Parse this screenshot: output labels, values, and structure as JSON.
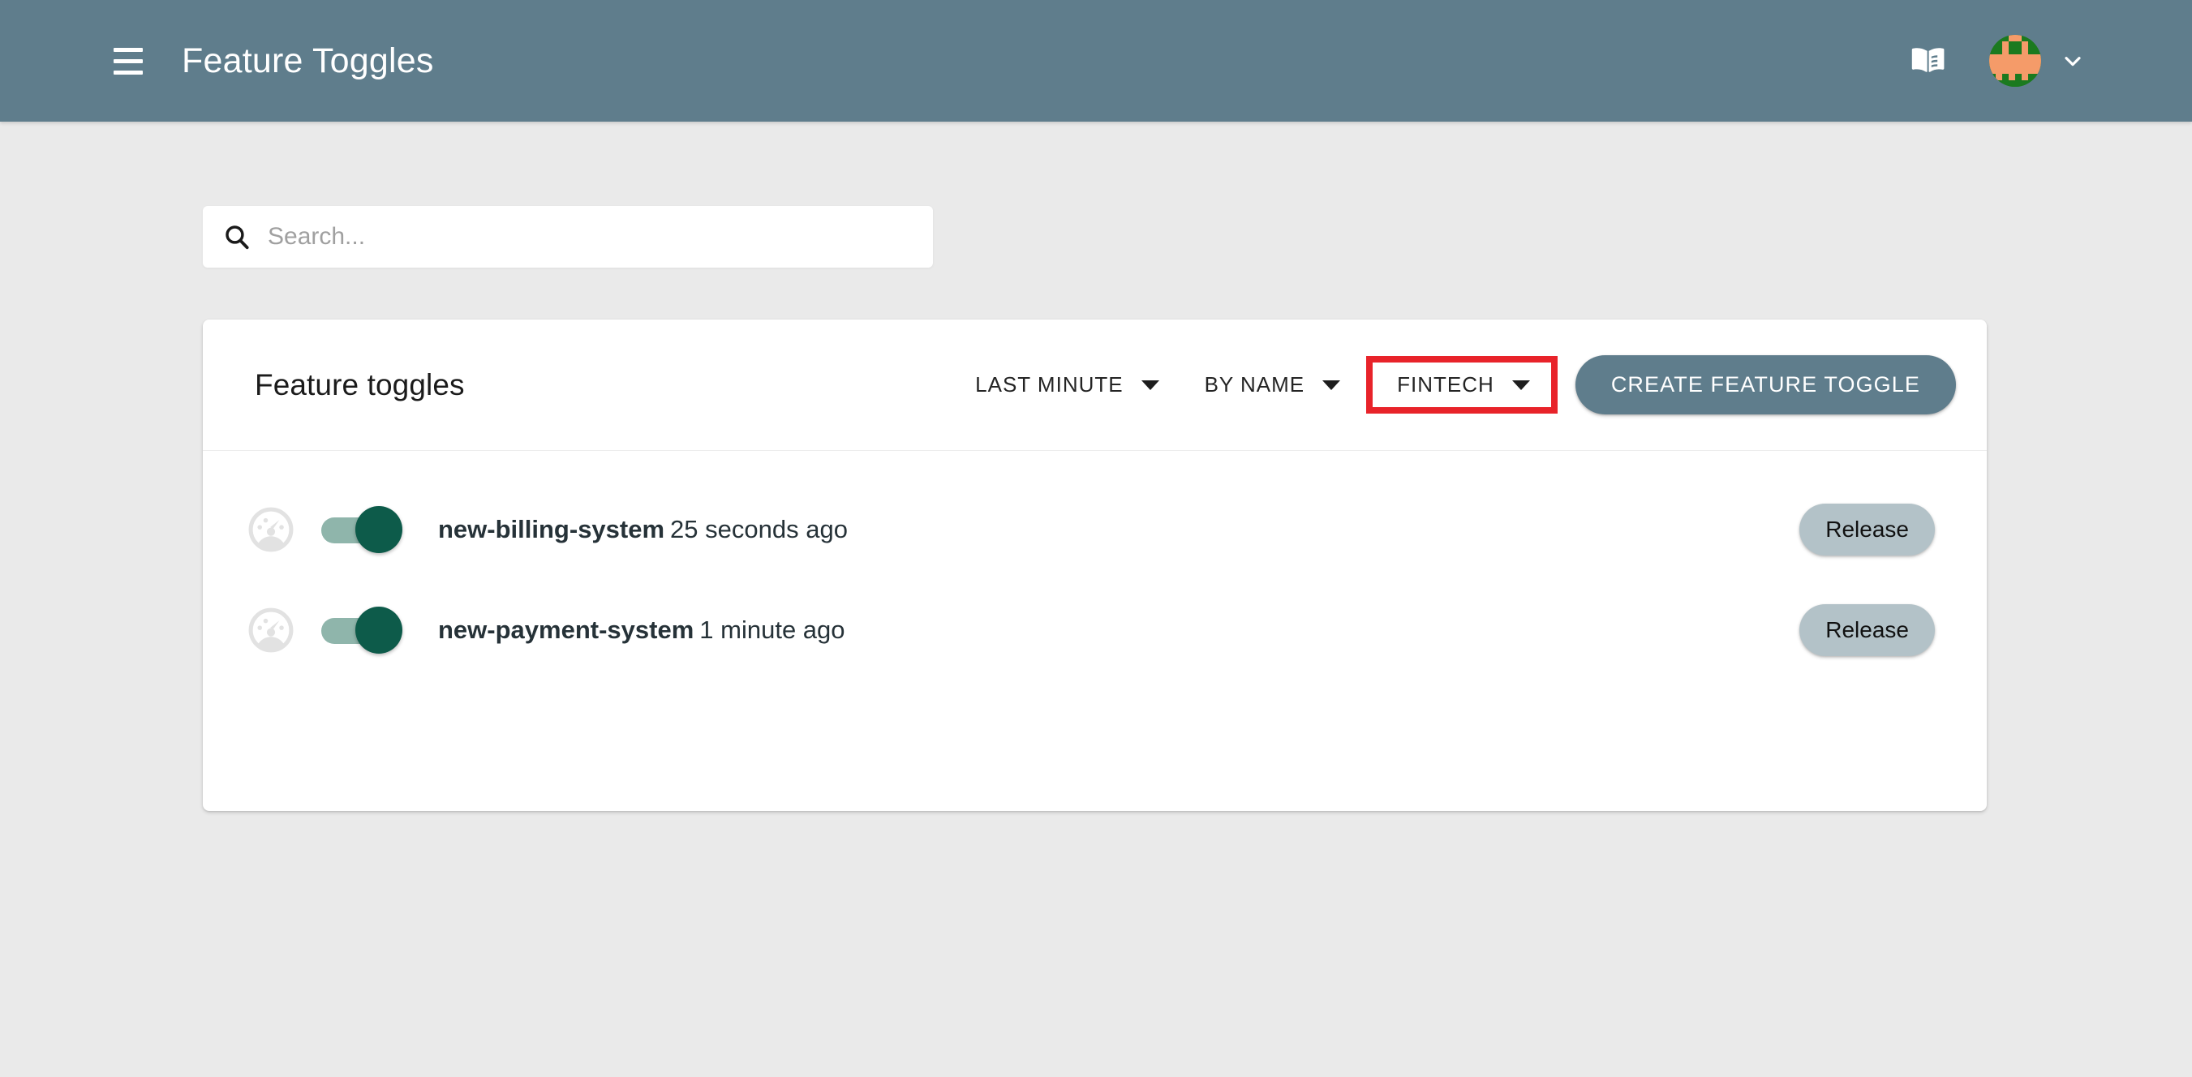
{
  "theme": {
    "appbar_bg": "#5F7D8C",
    "page_bg": "#EAEAEA",
    "card_bg": "#FFFFFF",
    "accent": "#5F7D8C",
    "highlight_border": "#E8232A",
    "toggle_track": "#8FB5AB",
    "toggle_thumb": "#0D5B4A",
    "chip_bg": "#B3C2C8",
    "avatar_bg": "#1B7A1F",
    "avatar_fg": "#F59B69"
  },
  "appbar": {
    "menu_icon": "hamburger-menu-icon",
    "title": "Feature Toggles",
    "book_icon": "book-icon",
    "avatar_icon": "user-avatar-identicon",
    "chevron_icon": "chevron-down-icon"
  },
  "search": {
    "icon": "search-icon",
    "value": "",
    "placeholder": "Search..."
  },
  "card": {
    "title": "Feature toggles",
    "filters": [
      {
        "label": "LAST MINUTE",
        "icon": "caret-down-icon",
        "highlighted": false
      },
      {
        "label": "BY NAME",
        "icon": "caret-down-icon",
        "highlighted": false
      },
      {
        "label": "FINTECH",
        "icon": "caret-down-icon",
        "highlighted": true
      }
    ],
    "create_button": "CREATE FEATURE TOGGLE",
    "rows": [
      {
        "metrics_icon": "gauge-icon",
        "toggle_state": "on",
        "name": "new-billing-system",
        "time": "25 seconds ago",
        "action": "Release"
      },
      {
        "metrics_icon": "gauge-icon",
        "toggle_state": "on",
        "name": "new-payment-system",
        "time": "1 minute ago",
        "action": "Release"
      }
    ]
  }
}
